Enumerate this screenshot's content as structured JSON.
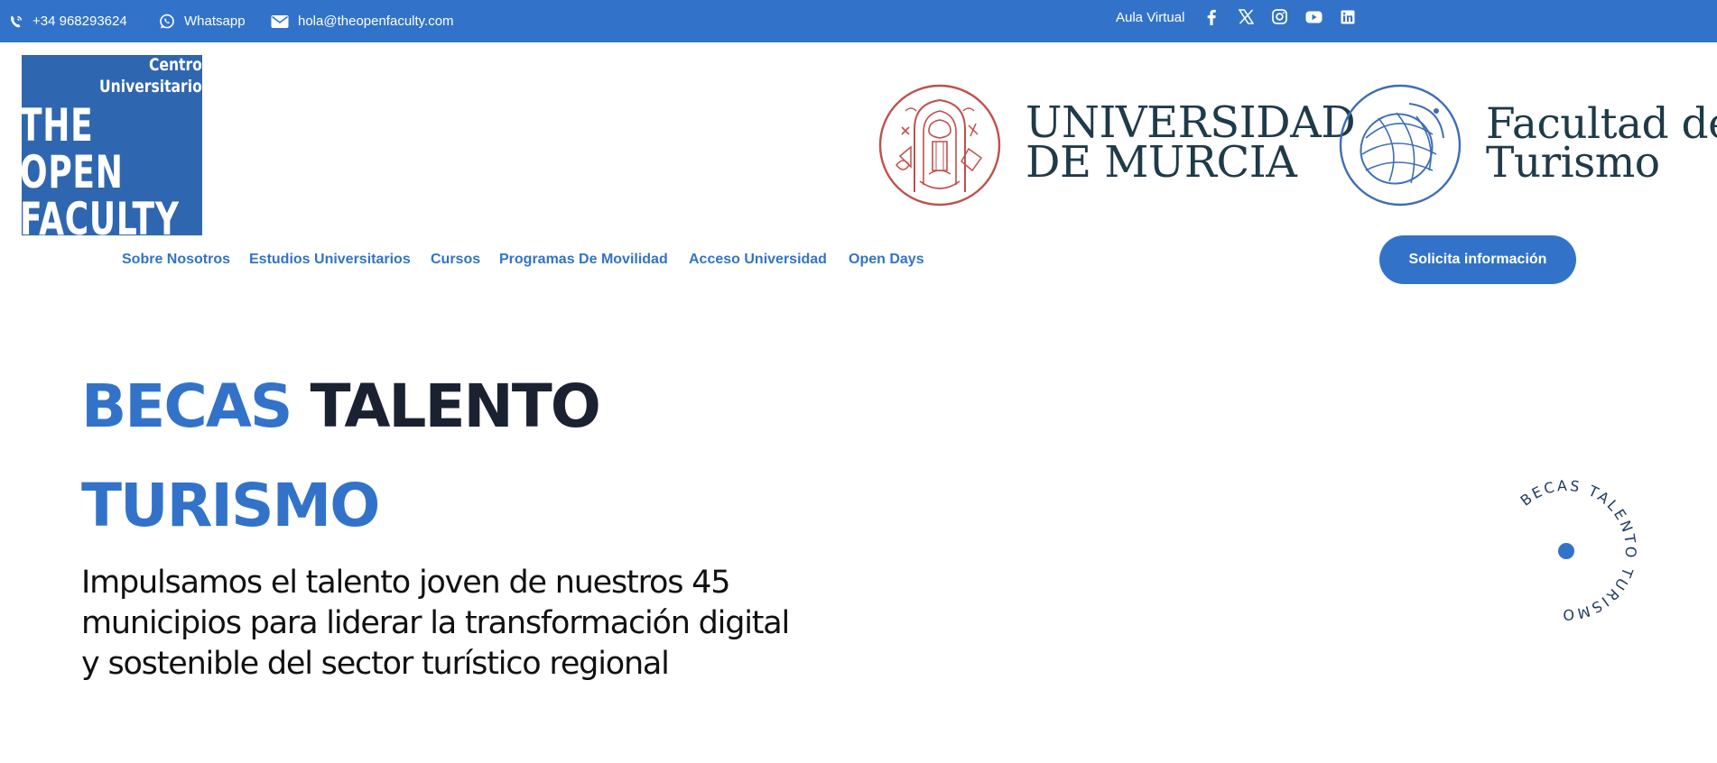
{
  "topbar": {
    "phone": "+34 968293624",
    "whatsapp": "Whatsapp",
    "email": "hola@theopenfaculty.com",
    "aula_virtual": "Aula Virtual",
    "social_icons": [
      "facebook-icon",
      "x-icon",
      "instagram-icon",
      "youtube-icon",
      "linkedin-icon"
    ]
  },
  "logos": {
    "open_faculty": {
      "line1": "Centro",
      "line2": "Universitario",
      "line3": "THE",
      "line4": "OPEN",
      "line5": "FACULTY"
    },
    "universidad": {
      "line1": "UNIVERSIDAD",
      "line2": "DE MURCIA"
    },
    "facultad": {
      "line1": "Facultad de",
      "line2": "Turismo"
    }
  },
  "nav": {
    "items": [
      {
        "label": "Sobre Nosotros"
      },
      {
        "label": "Estudios Universitarios"
      },
      {
        "label": "Cursos"
      },
      {
        "label": "Programas De Movilidad"
      },
      {
        "label": "Acceso Universidad"
      },
      {
        "label": "Open Days"
      }
    ],
    "cta": "Solicita información"
  },
  "hero": {
    "title_word1": "BECAS",
    "title_word2": "TALENTO",
    "title_word3": "TURISMO",
    "description": "Impulsamos el talento joven de nuestros 45 municipios para liderar la transformación digital y sostenible del sector turístico regional"
  },
  "badge": {
    "circular_text": "BECAS TALENTO TURISMO"
  },
  "colors": {
    "brand_blue": "#3273c9",
    "dark_text": "#1a2232",
    "um_red": "#c0504d",
    "um_navy": "#1f3a48",
    "turismo_blue": "#3d6eb4"
  }
}
